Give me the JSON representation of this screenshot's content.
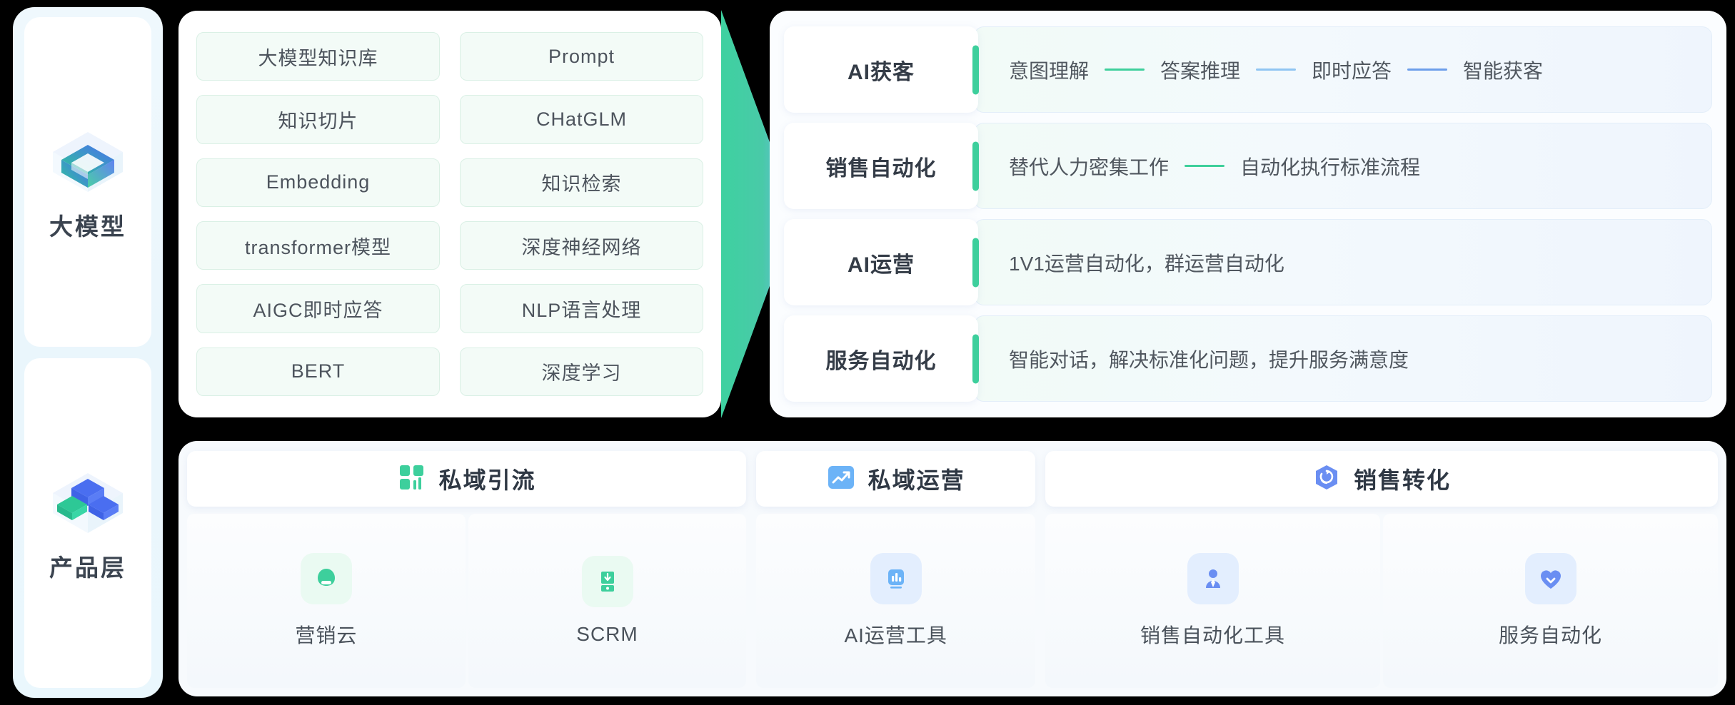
{
  "sidebar": {
    "items": [
      {
        "label": "大模型",
        "icon": "cube-layer-icon"
      },
      {
        "label": "产品层",
        "icon": "cubes-stack-icon"
      }
    ]
  },
  "tech_panel": {
    "tags": [
      "大模型知识库",
      "Prompt",
      "知识切片",
      "CHatGLM",
      "Embedding",
      "知识检索",
      "transformer模型",
      "深度神经网络",
      "AIGC即时应答",
      "NLP语言处理",
      "BERT",
      "深度学习"
    ]
  },
  "arrow": {
    "name": "chevron-right-arrow",
    "color_start": "#3ed1a0",
    "color_end": "#6fb4f0"
  },
  "capabilities": {
    "rows": [
      {
        "name": "AI获客",
        "accent": "#3dcf9c",
        "steps": [
          "意图理解",
          "答案推理",
          "即时应答",
          "智能获客"
        ],
        "links": [
          "#3ecf9b",
          "#8fc5f2",
          "#6d9eea"
        ]
      },
      {
        "name": "销售自动化",
        "accent": "#3dcf9c",
        "steps": [
          "替代人力密集工作",
          "自动化执行标准流程"
        ],
        "links": [
          "#3ecf9b"
        ]
      },
      {
        "name": "AI运营",
        "accent": "#3dcf9c",
        "steps": [
          "1V1运营自动化，群运营自动化"
        ],
        "links": []
      },
      {
        "name": "服务自动化",
        "accent": "#3dcf9c",
        "steps": [
          "智能对话，解决标准化问题，提升服务满意度"
        ],
        "links": []
      }
    ]
  },
  "products": {
    "groups": [
      {
        "title": "私域引流",
        "icon": "grid-blocks-icon",
        "icon_color": "#3dcf9c",
        "items": [
          {
            "label": "营销云",
            "icon": "cloud-icon",
            "tone": "green"
          },
          {
            "label": "SCRM",
            "icon": "phone-download-icon",
            "tone": "green"
          }
        ]
      },
      {
        "title": "私域运营",
        "icon": "trend-up-icon",
        "icon_color": "#6cb3f7",
        "items": [
          {
            "label": "AI运营工具",
            "icon": "bar-chart-icon",
            "tone": "blue"
          }
        ]
      },
      {
        "title": "销售转化",
        "icon": "cube-sync-icon",
        "icon_color": "#6a8ef2",
        "items": [
          {
            "label": "销售自动化工具",
            "icon": "person-tie-icon",
            "tone": "blue"
          },
          {
            "label": "服务自动化",
            "icon": "heart-icon",
            "tone": "blue"
          }
        ]
      }
    ]
  }
}
